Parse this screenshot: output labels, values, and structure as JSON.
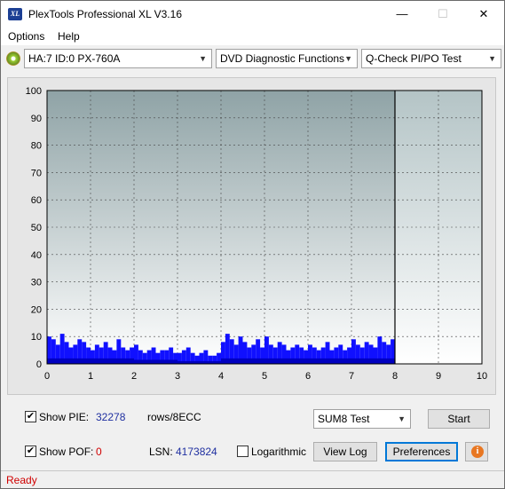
{
  "window": {
    "title": "PlexTools Professional XL V3.16",
    "icon_text": "XL"
  },
  "window_controls": {
    "minimize": "—",
    "maximize": "☐",
    "close": "✕"
  },
  "menu": {
    "options": "Options",
    "help": "Help"
  },
  "toolbar": {
    "drive": "HA:7 ID:0  PX-760A",
    "function": "DVD Diagnostic Functions",
    "test": "Q-Check PI/PO Test"
  },
  "chart_data": {
    "type": "bar",
    "xlim": [
      0,
      10
    ],
    "ylim": [
      0,
      100
    ],
    "x_ticks": [
      "0",
      "1",
      "2",
      "3",
      "4",
      "5",
      "6",
      "7",
      "8",
      "9",
      "10"
    ],
    "y_ticks": [
      "0",
      "10",
      "20",
      "30",
      "40",
      "50",
      "60",
      "70",
      "80",
      "90",
      "100"
    ],
    "grid": true,
    "data_end_x": 8,
    "series": [
      {
        "color": "#1010ff",
        "x": [
          0.05,
          0.15,
          0.25,
          0.35,
          0.45,
          0.55,
          0.65,
          0.75,
          0.85,
          0.95,
          1.05,
          1.15,
          1.25,
          1.35,
          1.45,
          1.55,
          1.65,
          1.75,
          1.85,
          1.95,
          2.05,
          2.15,
          2.25,
          2.35,
          2.45,
          2.55,
          2.65,
          2.75,
          2.85,
          2.95,
          3.05,
          3.15,
          3.25,
          3.35,
          3.45,
          3.55,
          3.65,
          3.75,
          3.85,
          3.95,
          4.05,
          4.15,
          4.25,
          4.35,
          4.45,
          4.55,
          4.65,
          4.75,
          4.85,
          4.95,
          5.05,
          5.15,
          5.25,
          5.35,
          5.45,
          5.55,
          5.65,
          5.75,
          5.85,
          5.95,
          6.05,
          6.15,
          6.25,
          6.35,
          6.45,
          6.55,
          6.65,
          6.75,
          6.85,
          6.95,
          7.05,
          7.15,
          7.25,
          7.35,
          7.45,
          7.55,
          7.65,
          7.75,
          7.85,
          7.95
        ],
        "values": [
          10,
          9,
          7,
          11,
          8,
          6,
          7,
          9,
          8,
          6,
          5,
          7,
          6,
          8,
          6,
          5,
          9,
          6,
          5,
          6,
          7,
          5,
          4,
          5,
          6,
          4,
          5,
          5,
          6,
          4,
          4,
          5,
          6,
          4,
          3,
          4,
          5,
          3,
          3,
          4,
          8,
          11,
          9,
          7,
          10,
          8,
          6,
          7,
          9,
          6,
          10,
          7,
          6,
          8,
          7,
          5,
          6,
          7,
          6,
          5,
          7,
          6,
          5,
          6,
          8,
          5,
          6,
          7,
          5,
          6,
          9,
          7,
          6,
          8,
          7,
          6,
          10,
          8,
          7,
          9
        ]
      },
      {
        "color": "#0000c0",
        "x": [
          0.5,
          1.5,
          2.5,
          3.5,
          4.5,
          5.5,
          6.5,
          7.5
        ],
        "values": [
          2,
          2,
          1.5,
          1,
          2,
          2,
          2,
          2
        ]
      }
    ]
  },
  "controls": {
    "show_pie_label": "Show PIE:",
    "pie_value": "32278",
    "pie_unit": "rows/8ECC",
    "show_pof_label": "Show POF:",
    "pof_value": "0",
    "lsn_label": "LSN:",
    "lsn_value": "4173824",
    "logarithmic_label": "Logarithmic",
    "sum_select": "SUM8 Test",
    "start_button": "Start",
    "view_log_button": "View Log",
    "preferences_button": "Preferences",
    "info_glyph": "i",
    "check_glyph": "✔"
  },
  "status": {
    "text": "Ready"
  }
}
